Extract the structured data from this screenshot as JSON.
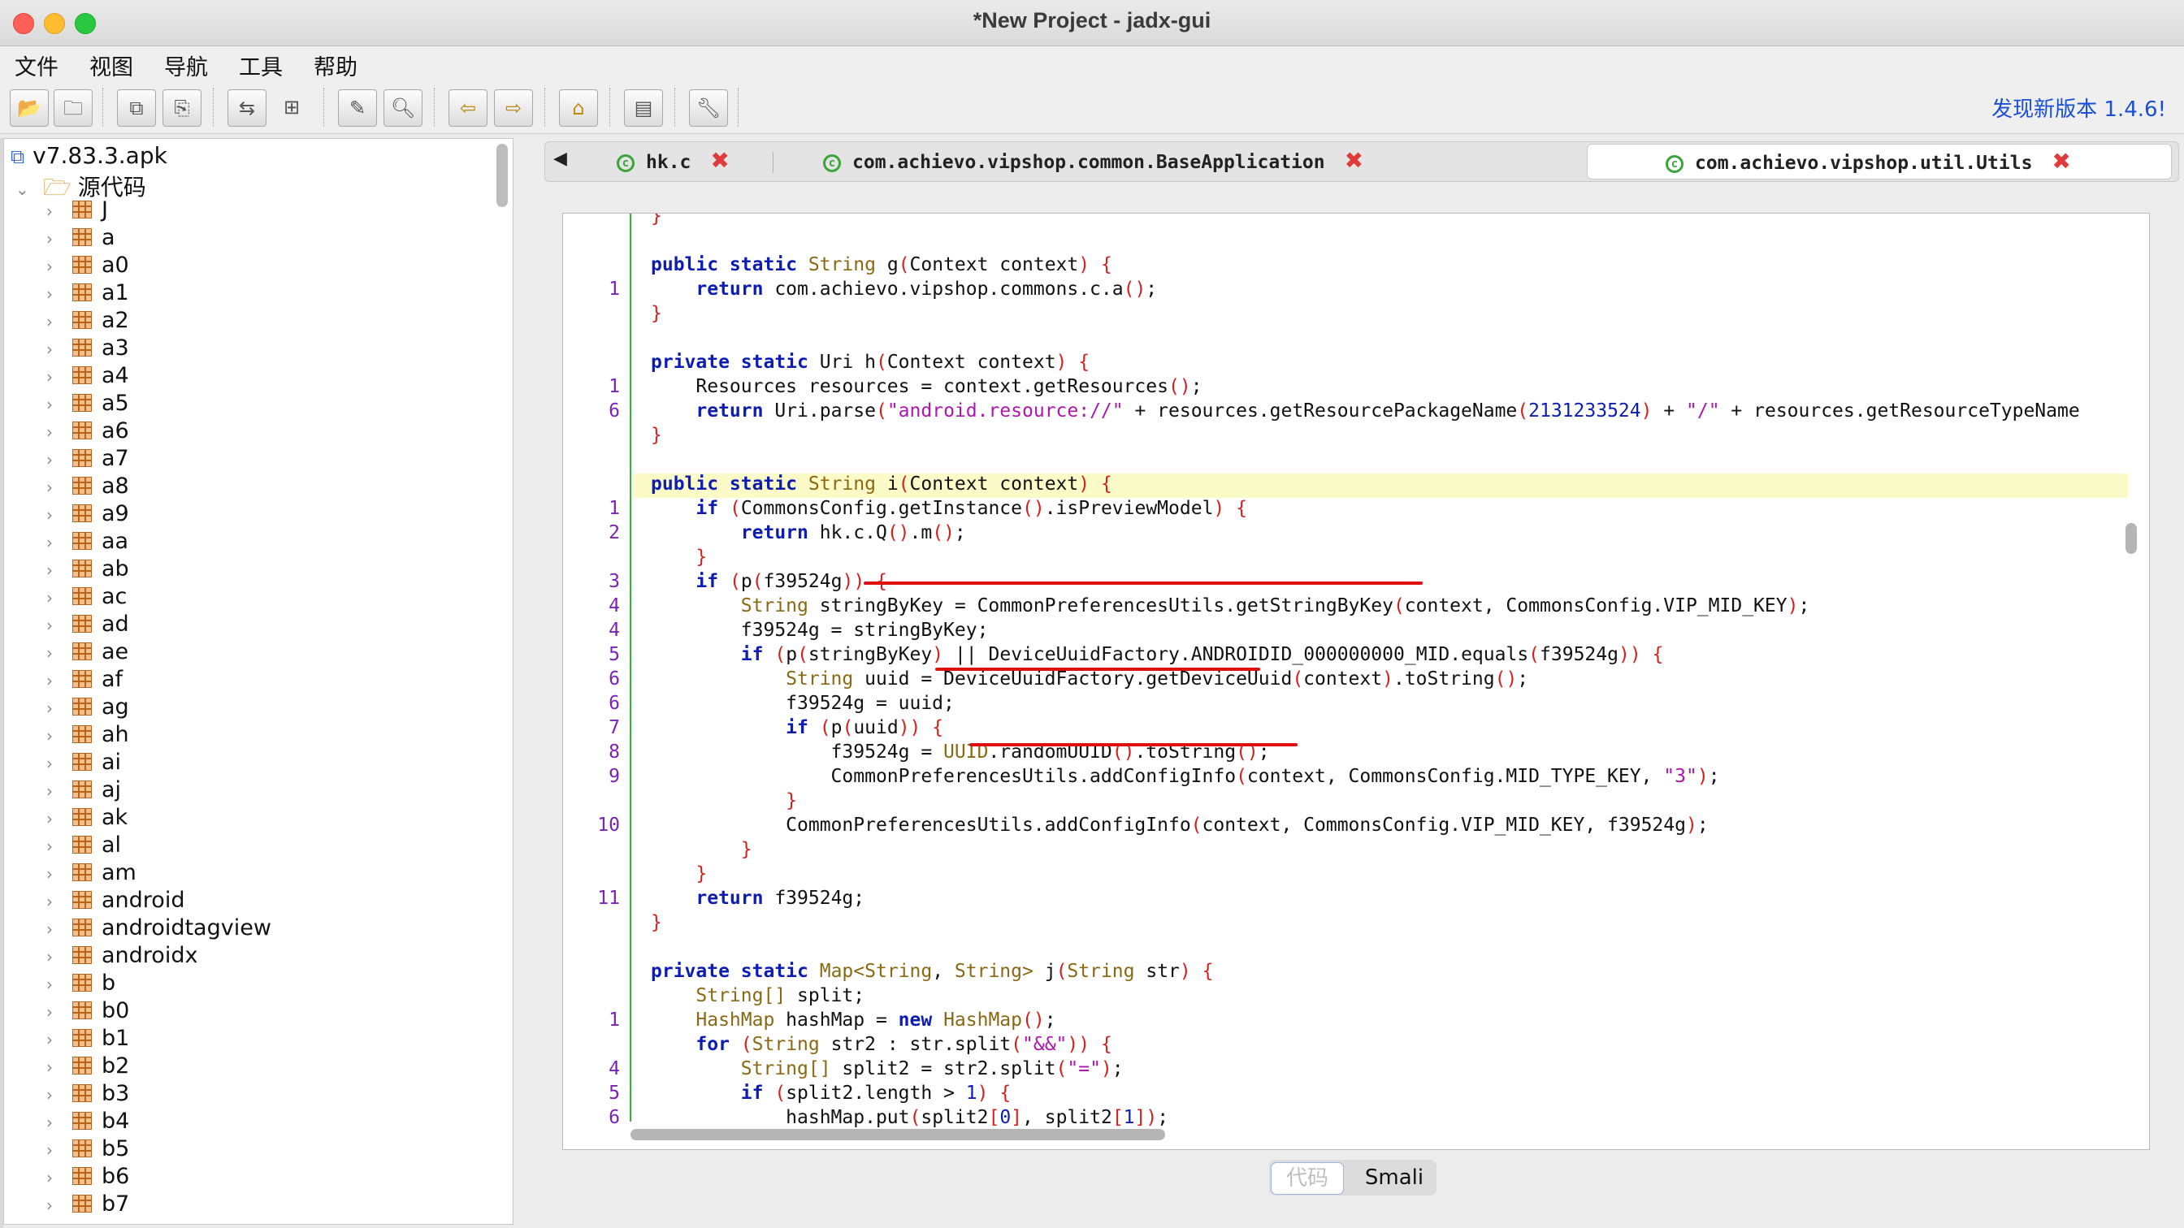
{
  "window": {
    "title": "*New Project - jadx-gui"
  },
  "menu": [
    "文件",
    "视图",
    "导航",
    "工具",
    "帮助"
  ],
  "toolbar": {
    "update_text": "发现新版本 1.4.6!",
    "buttons": [
      "open-project-icon",
      "add-files-icon",
      "save-all-icon",
      "export-icon",
      "sync-icon",
      "flatten-icon",
      "decompile-icon",
      "search-icon",
      "back-icon",
      "forward-icon",
      "deobfuscation-icon",
      "log-icon",
      "preferences-icon"
    ]
  },
  "tree": {
    "root": "v7.83.3.apk",
    "source": "源代码",
    "packages": [
      "J",
      "a",
      "a0",
      "a1",
      "a2",
      "a3",
      "a4",
      "a5",
      "a6",
      "a7",
      "a8",
      "a9",
      "aa",
      "ab",
      "ac",
      "ad",
      "ae",
      "af",
      "ag",
      "ah",
      "ai",
      "aj",
      "ak",
      "al",
      "am",
      "android",
      "androidtagview",
      "androidx",
      "b",
      "b0",
      "b1",
      "b2",
      "b3",
      "b4",
      "b5",
      "b6",
      "b7"
    ]
  },
  "tabs": [
    {
      "label": "hk.c"
    },
    {
      "label": "com.achievo.vipshop.common.BaseApplication"
    },
    {
      "label": "com.achievo.vipshop.util.Utils"
    }
  ],
  "code": {
    "lines": [
      {
        "ln": "",
        "html": "<span class='br'>}</span>"
      },
      {
        "ln": "",
        "html": ""
      },
      {
        "ln": "",
        "html": "<span class='kw'>public static</span> <span class='ty'>String</span> g<span class='br'>(</span>Context context<span class='br'>)</span> <span class='br'>{</span>"
      },
      {
        "ln": "1",
        "html": "    <span class='kw'>return</span> com.achievo.vipshop.commons.c.a<span class='br'>()</span>;"
      },
      {
        "ln": "",
        "html": "<span class='br'>}</span>"
      },
      {
        "ln": "",
        "html": ""
      },
      {
        "ln": "",
        "html": "<span class='kw'>private static</span> Uri h<span class='br'>(</span>Context context<span class='br'>)</span> <span class='br'>{</span>"
      },
      {
        "ln": "1",
        "html": "    Resources resources = context.getResources<span class='br'>()</span>;"
      },
      {
        "ln": "6",
        "html": "    <span class='kw'>return</span> Uri.parse<span class='br'>(</span><span class='str'>\"android.resource://\"</span> + resources.getResourcePackageName<span class='br'>(</span><span class='num'>2131233524</span><span class='br'>)</span> + <span class='str'>\"/\"</span> + resources.getResourceTypeName"
      },
      {
        "ln": "",
        "html": "<span class='br'>}</span>"
      },
      {
        "ln": "",
        "html": ""
      },
      {
        "ln": "",
        "html": "<span class='kw'>public static</span> <span class='ty'>String</span> i<span class='br'>(</span>Context context<span class='br'>)</span> <span class='br'>{</span>"
      },
      {
        "ln": "1",
        "html": "    <span class='kw'>if</span> <span class='br'>(</span>CommonsConfig.getInstance<span class='br'>()</span>.isPreviewModel<span class='br'>)</span> <span class='br'>{</span>"
      },
      {
        "ln": "2",
        "html": "        <span class='kw'>return</span> hk.c.Q<span class='br'>()</span>.m<span class='br'>()</span>;"
      },
      {
        "ln": "",
        "html": "    <span class='br'>}</span>"
      },
      {
        "ln": "3",
        "html": "    <span class='kw'>if</span> <span class='br'>(</span>p<span class='br'>(</span>f39524g<span class='br'>))</span> <span class='br'>{</span>"
      },
      {
        "ln": "4",
        "html": "        <span class='ty'>String</span> stringByKey = CommonPreferencesUtils.getStringByKey<span class='br'>(</span>context, CommonsConfig.VIP_MID_KEY<span class='br'>)</span>;"
      },
      {
        "ln": "4",
        "html": "        f39524g = stringByKey;"
      },
      {
        "ln": "5",
        "html": "        <span class='kw'>if</span> <span class='br'>(</span>p<span class='br'>(</span>stringByKey<span class='br'>)</span> || DeviceUuidFactory.ANDROIDID_000000000_MID.equals<span class='br'>(</span>f39524g<span class='br'>))</span> <span class='br'>{</span>"
      },
      {
        "ln": "6",
        "html": "            <span class='ty'>String</span> uuid = DeviceUuidFactory.getDeviceUuid<span class='br'>(</span>context<span class='br'>)</span>.toString<span class='br'>()</span>;"
      },
      {
        "ln": "6",
        "html": "            f39524g = uuid;"
      },
      {
        "ln": "7",
        "html": "            <span class='kw'>if</span> <span class='br'>(</span>p<span class='br'>(</span>uuid<span class='br'>))</span> <span class='br'>{</span>"
      },
      {
        "ln": "8",
        "html": "                f39524g = <span class='ty'>UUID</span>.randomUUID<span class='br'>()</span>.toString<span class='br'>()</span>;"
      },
      {
        "ln": "9",
        "html": "                CommonPreferencesUtils.addConfigInfo<span class='br'>(</span>context, CommonsConfig.MID_TYPE_KEY, <span class='str'>\"3\"</span><span class='br'>)</span>;"
      },
      {
        "ln": "",
        "html": "            <span class='br'>}</span>"
      },
      {
        "ln": "10",
        "html": "            CommonPreferencesUtils.addConfigInfo<span class='br'>(</span>context, CommonsConfig.VIP_MID_KEY, f39524g<span class='br'>)</span>;"
      },
      {
        "ln": "",
        "html": "        <span class='br'>}</span>"
      },
      {
        "ln": "",
        "html": "    <span class='br'>}</span>"
      },
      {
        "ln": "11",
        "html": "    <span class='kw'>return</span> f39524g;"
      },
      {
        "ln": "",
        "html": "<span class='br'>}</span>"
      },
      {
        "ln": "",
        "html": ""
      },
      {
        "ln": "",
        "html": "<span class='kw'>private static</span> <span class='ty'>Map&lt;String</span>, <span class='ty'>String&gt;</span> j<span class='br'>(</span><span class='ty'>String</span> str<span class='br'>)</span> <span class='br'>{</span>"
      },
      {
        "ln": "",
        "html": "    <span class='ty'>String[]</span> split;"
      },
      {
        "ln": "1",
        "html": "    <span class='ty'>HashMap</span> hashMap = <span class='kw'>new</span> <span class='ty'>HashMap</span><span class='br'>()</span>;"
      },
      {
        "ln": "",
        "html": "    <span class='kw'>for</span> <span class='br'>(</span><span class='ty'>String</span> str2 : str.split<span class='br'>(</span><span class='str'>\"&amp;&amp;\"</span><span class='br'>))</span> <span class='br'>{</span>"
      },
      {
        "ln": "4",
        "html": "        <span class='ty'>String[]</span> split2 = str2.split<span class='br'>(</span><span class='str'>\"=\"</span><span class='br'>)</span>;"
      },
      {
        "ln": "5",
        "html": "        <span class='kw'>if</span> <span class='br'>(</span>split2.length &gt; <span class='num'>1</span><span class='br'>)</span> <span class='br'>{</span>"
      },
      {
        "ln": "6",
        "html": "            hashMap.put<span class='br'>(</span>split2<span class='br'>[</span><span class='num'>0</span><span class='br'>]</span>, split2<span class='br'>[</span><span class='num'>1</span><span class='br'>])</span>;"
      }
    ]
  },
  "bottom_tabs": {
    "code": "代码",
    "smali": "Smali"
  }
}
